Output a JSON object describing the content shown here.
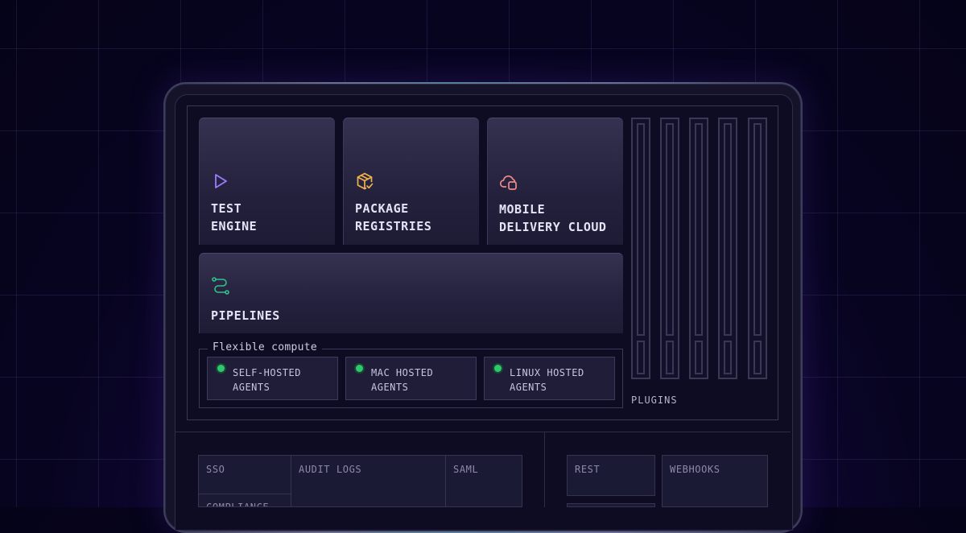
{
  "products": {
    "test_engine": {
      "line1": "TEST",
      "line2": "ENGINE",
      "icon": "play-icon",
      "color": "#9b7bff"
    },
    "package_registries": {
      "line1": "PACKAGE",
      "line2": "REGISTRIES",
      "icon": "package-check-icon",
      "color": "#f2b24a"
    },
    "mobile_delivery_cloud": {
      "line1": "MOBILE",
      "line2": "DELIVERY CLOUD",
      "icon": "cloud-icon",
      "color": "#f08a8a"
    },
    "pipelines": {
      "label": "PIPELINES",
      "icon": "pipeline-icon",
      "color": "#2fc28a"
    }
  },
  "compute": {
    "title": "Flexible compute",
    "agents": [
      {
        "line1": "SELF-HOSTED",
        "line2": "AGENTS",
        "status_color": "#2fc86c"
      },
      {
        "line1": "MAC HOSTED",
        "line2": "AGENTS",
        "status_color": "#2fc86c"
      },
      {
        "line1": "LINUX HOSTED",
        "line2": "AGENTS",
        "status_color": "#2fc86c"
      }
    ]
  },
  "plugins": {
    "label": "PLUGINS"
  },
  "security": {
    "sso": "SSO",
    "audit_logs": "AUDIT LOGS",
    "saml": "SAML",
    "compliance": "COMPLIANCE"
  },
  "api": {
    "rest": "REST",
    "webhooks": "WEBHOOKS"
  }
}
